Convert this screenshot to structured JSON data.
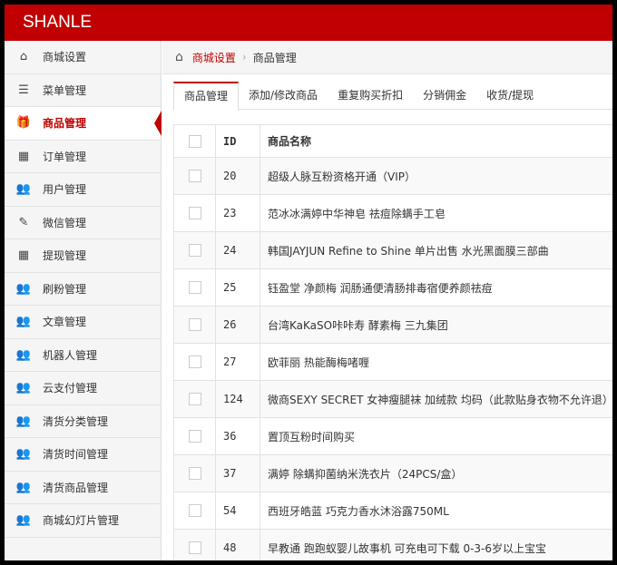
{
  "app": {
    "title": "SHANLE"
  },
  "sidebar": {
    "items": [
      {
        "label": "商城设置",
        "icon": "home-icon",
        "glyph": "⌂"
      },
      {
        "label": "菜单管理",
        "icon": "list-icon",
        "glyph": "☰"
      },
      {
        "label": "商品管理",
        "icon": "gift-icon",
        "glyph": "🎁",
        "active": true
      },
      {
        "label": "订单管理",
        "icon": "calendar-icon",
        "glyph": "▦"
      },
      {
        "label": "用户管理",
        "icon": "users-icon",
        "glyph": "👥"
      },
      {
        "label": "微信管理",
        "icon": "edit-icon",
        "glyph": "✎"
      },
      {
        "label": "提现管理",
        "icon": "calendar-icon",
        "glyph": "▦"
      },
      {
        "label": "刷粉管理",
        "icon": "users-icon",
        "glyph": "👥"
      },
      {
        "label": "文章管理",
        "icon": "users-icon",
        "glyph": "👥"
      },
      {
        "label": "机器人管理",
        "icon": "users-icon",
        "glyph": "👥"
      },
      {
        "label": "云支付管理",
        "icon": "users-icon",
        "glyph": "👥"
      },
      {
        "label": "清货分类管理",
        "icon": "users-icon",
        "glyph": "👥"
      },
      {
        "label": "清货时间管理",
        "icon": "users-icon",
        "glyph": "👥"
      },
      {
        "label": "清货商品管理",
        "icon": "users-icon",
        "glyph": "👥"
      },
      {
        "label": "商城幻灯片管理",
        "icon": "users-icon",
        "glyph": "👥"
      }
    ]
  },
  "breadcrumb": {
    "home_glyph": "⌂",
    "parent": "商城设置",
    "sep": "›",
    "current": "商品管理"
  },
  "tabs": [
    "商品管理",
    "添加/修改商品",
    "重复购买折扣",
    "分销佣金",
    "收货/提现"
  ],
  "table": {
    "headers": [
      "ID",
      "商品名称"
    ],
    "rows": [
      {
        "id": "20",
        "name": "超级人脉互粉资格开通（VIP）"
      },
      {
        "id": "23",
        "name": "范冰冰满婷中华神皂 祛痘除螨手工皂"
      },
      {
        "id": "24",
        "name": "韩国JAYJUN Refine to Shine 单片出售 水光黑面膜三部曲"
      },
      {
        "id": "25",
        "name": "钰盈堂 净颜梅 润肠通便清肠排毒宿便养颜祛痘"
      },
      {
        "id": "26",
        "name": "台湾KaKaSO咔咔寿 酵素梅 三九集团"
      },
      {
        "id": "27",
        "name": "欧菲丽 热能酶梅啫喱"
      },
      {
        "id": "124",
        "name": "微商SEXY SECRET 女神瘦腿袜 加绒款 均码（此款贴身衣物不允许退）"
      },
      {
        "id": "36",
        "name": "置顶互粉时间购买"
      },
      {
        "id": "37",
        "name": "满婷 除螨抑菌纳米洗衣片（24PCS/盒）"
      },
      {
        "id": "54",
        "name": "西班牙皓蓝 巧克力香水沐浴露750ML"
      },
      {
        "id": "48",
        "name": "早教通 跑跑蚁婴儿故事机 可充电可下载 0-3-6岁以上宝宝"
      }
    ]
  },
  "colors": {
    "brand": "#c00000"
  }
}
